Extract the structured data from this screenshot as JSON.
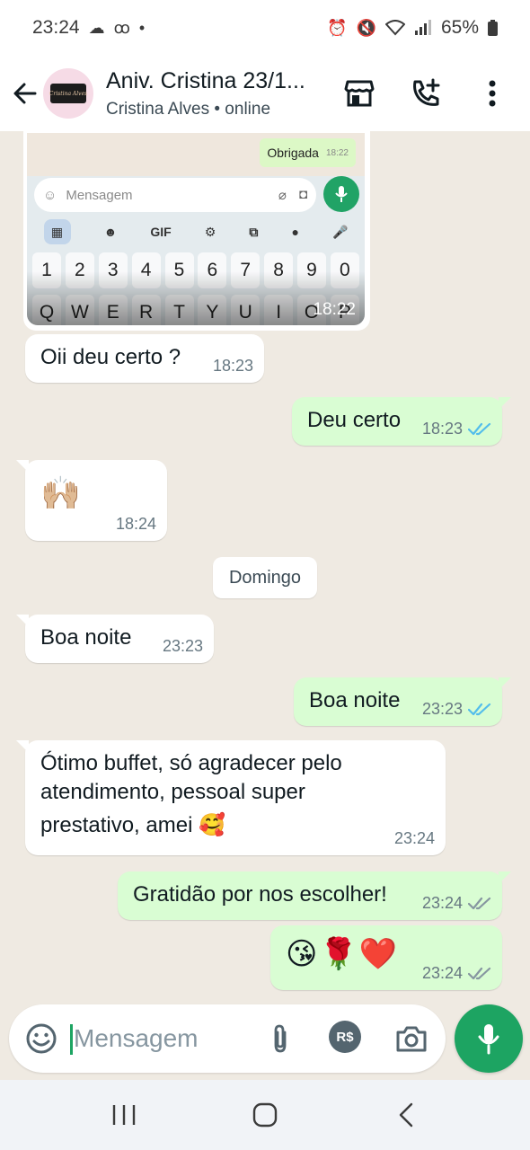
{
  "status_bar": {
    "time": "23:24",
    "battery": "65%"
  },
  "header": {
    "title": "Aniv. Cristina 23/1...",
    "subtitle": "Cristina Alves • online",
    "avatar_text": "Cristina Alves"
  },
  "image_message": {
    "inner_obrigada": "Obrigada",
    "inner_obrigada_time": "18:22",
    "inner_placeholder": "Mensagem",
    "inner_gif": "GIF",
    "number_keys": [
      "1",
      "2",
      "3",
      "4",
      "5",
      "6",
      "7",
      "8",
      "9",
      "0"
    ],
    "letter_keys": [
      "Q",
      "W",
      "E",
      "R",
      "T",
      "Y",
      "U",
      "I",
      "O",
      "P"
    ],
    "time": "18:22"
  },
  "messages": [
    {
      "dir": "in",
      "text": "Oii deu certo ?",
      "time": "18:23"
    },
    {
      "dir": "out",
      "text": "Deu certo",
      "time": "18:23",
      "ticks": "read"
    },
    {
      "dir": "in",
      "text": "🙌🏼",
      "time": "18:24"
    },
    {
      "dir": "in",
      "text": "Boa noite",
      "time": "23:23"
    },
    {
      "dir": "out",
      "text": "Boa noite",
      "time": "23:23",
      "ticks": "read"
    },
    {
      "dir": "in",
      "lines": [
        "Ótimo buffet, só agradecer pelo",
        "atendimento, pessoal super",
        "prestativo, amei 🥰"
      ],
      "time": "23:24"
    },
    {
      "dir": "out",
      "text": "Gratidão por nos escolher!",
      "time": "23:24",
      "ticks": "delivered"
    },
    {
      "dir": "out",
      "text": "😘🌹❤️",
      "time": "23:24",
      "ticks": "delivered"
    }
  ],
  "date_separator": "Domingo",
  "composer": {
    "placeholder": "Mensagem",
    "rs_label": "R$"
  },
  "colors": {
    "accent_green": "#1da462",
    "outgoing_bubble": "#d9fdd3",
    "incoming_bubble": "#ffffff",
    "chat_background": "#efeae2",
    "read_ticks": "#53bdeb",
    "delivered_ticks": "#8696a0"
  }
}
